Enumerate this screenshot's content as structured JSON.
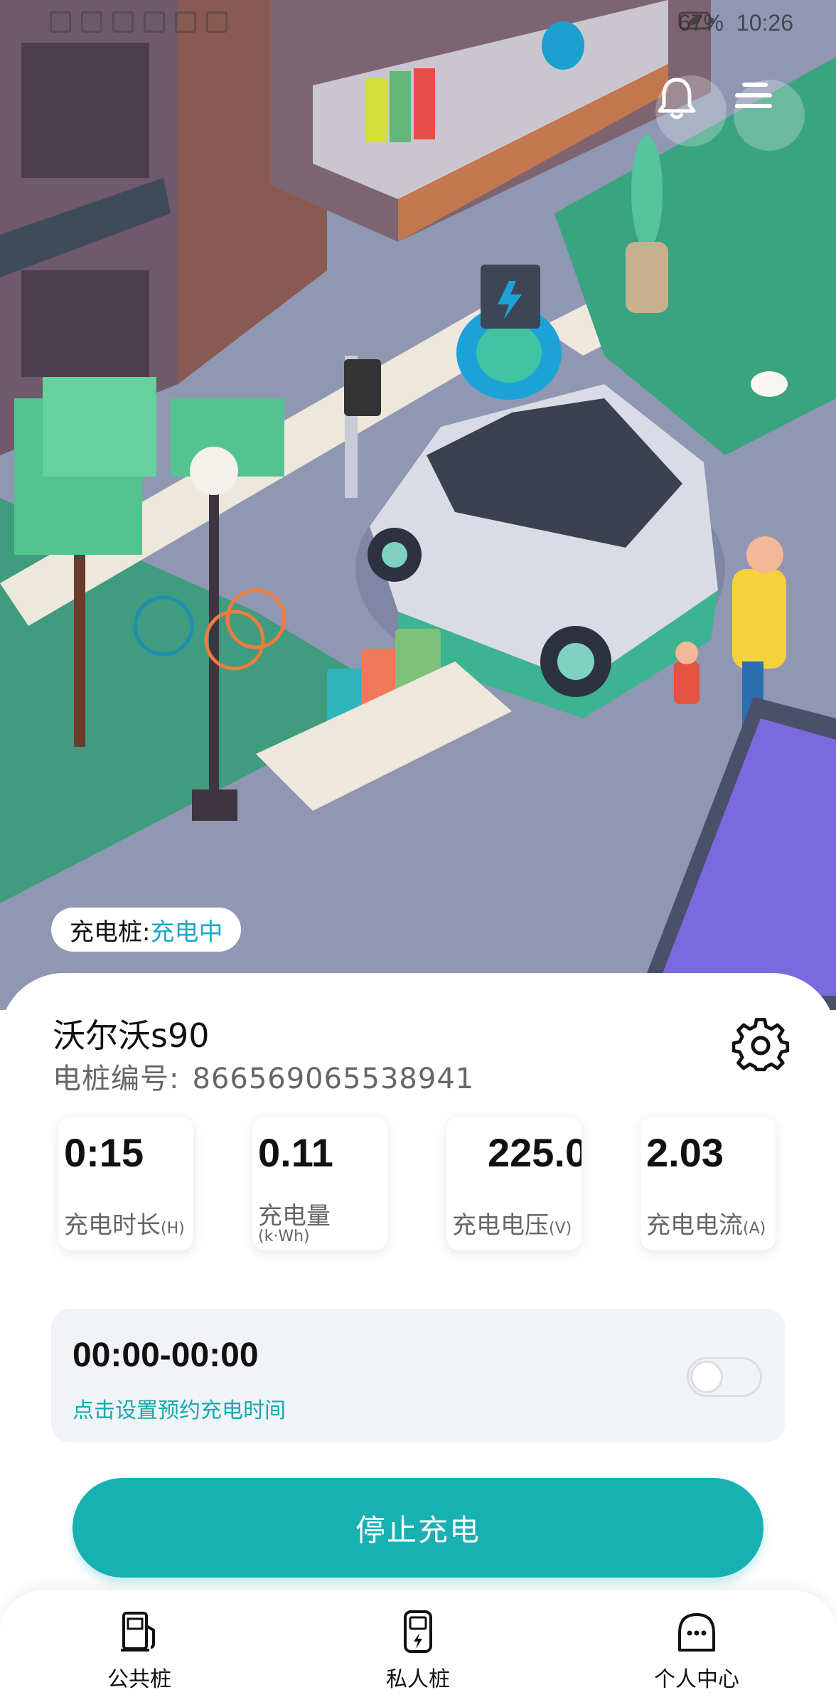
{
  "status_bar": {
    "battery": "67%",
    "time": "10:26"
  },
  "header": {
    "bell_icon": "bell-icon",
    "menu_icon": "menu-icon"
  },
  "chip": {
    "label": "充电桩:",
    "value": "充电中"
  },
  "vehicle": {
    "name": "沃尔沃s90",
    "pile_label": "电桩编号:",
    "pile_number": "866569065538941",
    "settings_icon": "gear-icon"
  },
  "stats": [
    {
      "value": "0:15",
      "label": "充电时长",
      "unit": "(H)"
    },
    {
      "value": "0.11",
      "label": "充电量",
      "unit": "(k·Wh)"
    },
    {
      "value": "225.0",
      "label": "充电电压",
      "unit": "(V)"
    },
    {
      "value": "2.03",
      "label": "充电电流",
      "unit": "(A)"
    }
  ],
  "schedule": {
    "time": "00:00-00:00",
    "hint": "点击设置预约充电时间",
    "toggle_on": false
  },
  "stop_button": "停止充电",
  "tabs": [
    {
      "label": "公共桩",
      "icon": "charging-pile-icon"
    },
    {
      "label": "私人桩",
      "icon": "private-charger-icon"
    },
    {
      "label": "个人中心",
      "icon": "profile-icon"
    }
  ],
  "colors": {
    "accent": "#18b1b3",
    "status_text": "#14a9c9"
  }
}
